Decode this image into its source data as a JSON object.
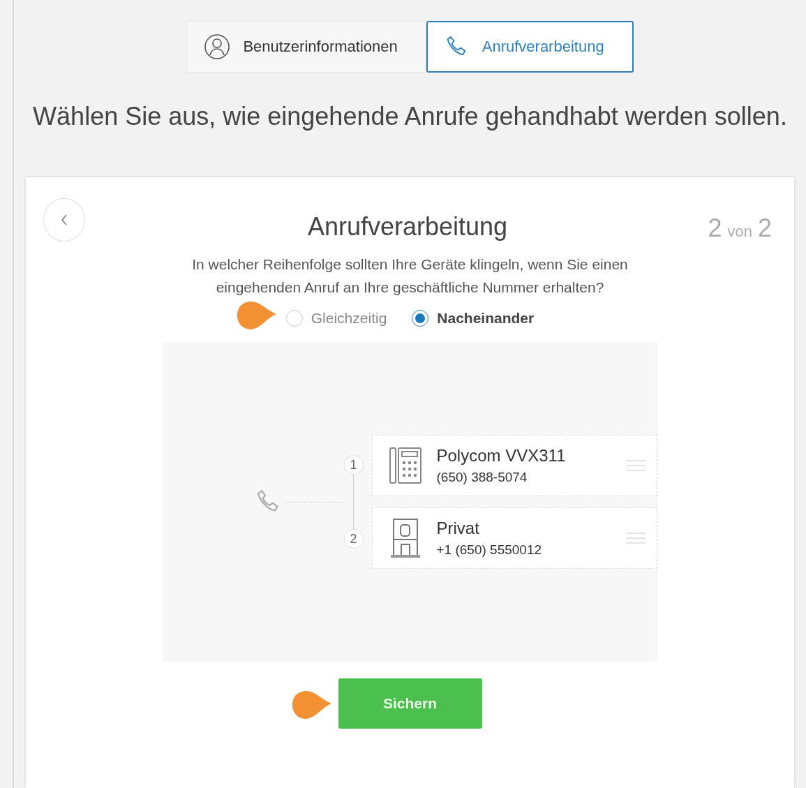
{
  "tabs": [
    {
      "label": "Benutzerinformationen",
      "kind": "user",
      "selected": false
    },
    {
      "label": "Anrufverarbeitung",
      "kind": "phone",
      "selected": true
    }
  ],
  "heading": "Wählen Sie aus, wie eingehende Anrufe gehandhabt werden sollen.",
  "card": {
    "title": "Anrufverarbeitung",
    "step": {
      "current": "2",
      "separator": "von",
      "total": "2"
    },
    "question": "In welcher Reihenfolge sollten Ihre Geräte klingeln, wenn Sie einen eingehenden Anruf an Ihre geschäftliche Nummer erhalten?",
    "ring_modes": [
      {
        "label": "Gleichzeitig",
        "selected": false
      },
      {
        "label": "Nacheinander",
        "selected": true
      }
    ],
    "devices": [
      {
        "order": "1",
        "kind": "deskphone",
        "name": "Polycom VVX311",
        "number": "(650) 388-5074"
      },
      {
        "order": "2",
        "kind": "home",
        "name": "Privat",
        "number": "+1 (650) 5550012"
      }
    ],
    "save_button": "Sichern"
  }
}
